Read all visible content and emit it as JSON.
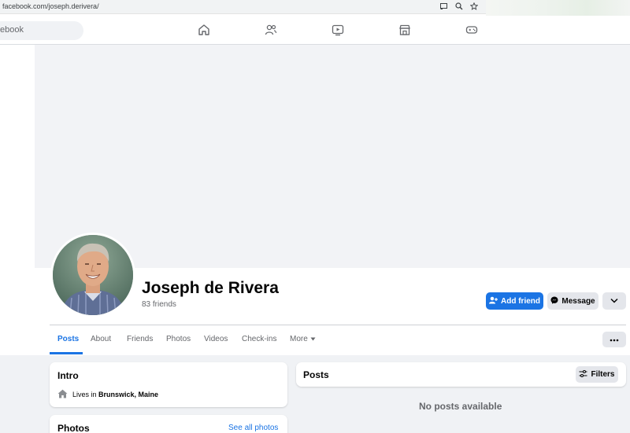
{
  "browser": {
    "url": "facebook.com/joseph.derivera/",
    "icons": [
      "cast-icon",
      "zoom-icon",
      "bookmark-star-icon"
    ]
  },
  "topnav": {
    "search_placeholder": "ebook",
    "icons": [
      "home-icon",
      "friends-icon",
      "watch-icon",
      "marketplace-icon",
      "gaming-icon"
    ]
  },
  "profile": {
    "name": "Joseph de Rivera",
    "friends": "83 friends"
  },
  "actions": {
    "add_friend": "Add friend",
    "message": "Message"
  },
  "tabs": [
    "Posts",
    "About",
    "Friends",
    "Photos",
    "Videos",
    "Check-ins",
    "More"
  ],
  "intro": {
    "title": "Intro",
    "lives_prefix": "Lives in ",
    "lives_place": "Brunswick, Maine"
  },
  "photos": {
    "title": "Photos",
    "see_all": "See all photos"
  },
  "posts": {
    "title": "Posts",
    "filters": "Filters",
    "empty": "No posts available"
  },
  "colors": {
    "accent": "#1b74e4",
    "page_bg": "#f0f2f5",
    "cover_bg": "#f2f3f6"
  }
}
